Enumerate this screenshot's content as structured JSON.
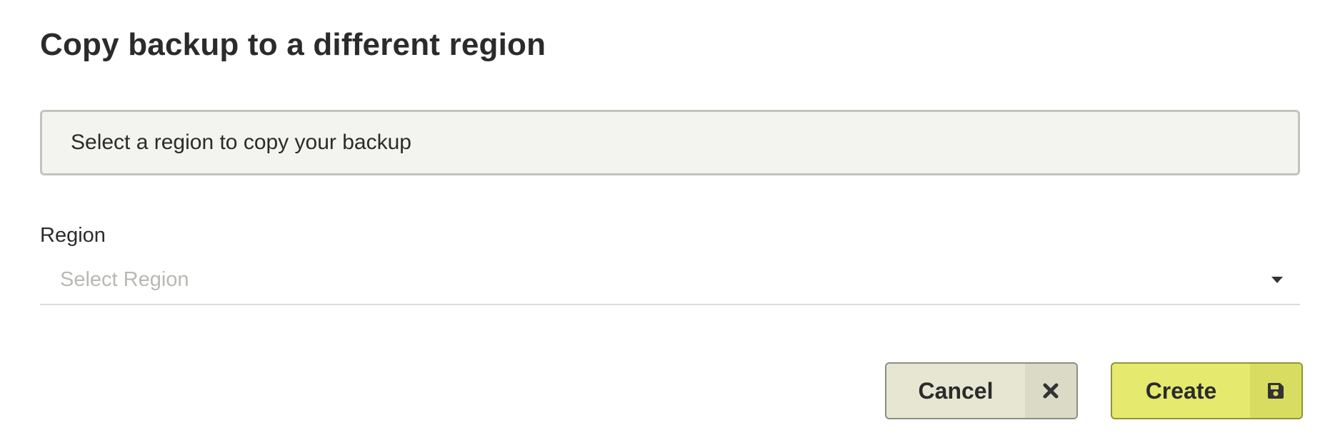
{
  "dialog": {
    "title": "Copy backup to a different region",
    "info_text": "Select a region to copy your backup",
    "region": {
      "label": "Region",
      "placeholder": "Select Region",
      "arrow_icon": "caret-down-icon"
    },
    "buttons": {
      "cancel": {
        "label": "Cancel",
        "icon": "close-icon"
      },
      "create": {
        "label": "Create",
        "icon": "save-icon"
      }
    }
  },
  "colors": {
    "text": "#2b2b2b",
    "info_bg": "#f3f3ef",
    "cancel_bg": "#e6e6d3",
    "create_bg": "#e5ea6f",
    "placeholder": "#b9b9b4"
  }
}
